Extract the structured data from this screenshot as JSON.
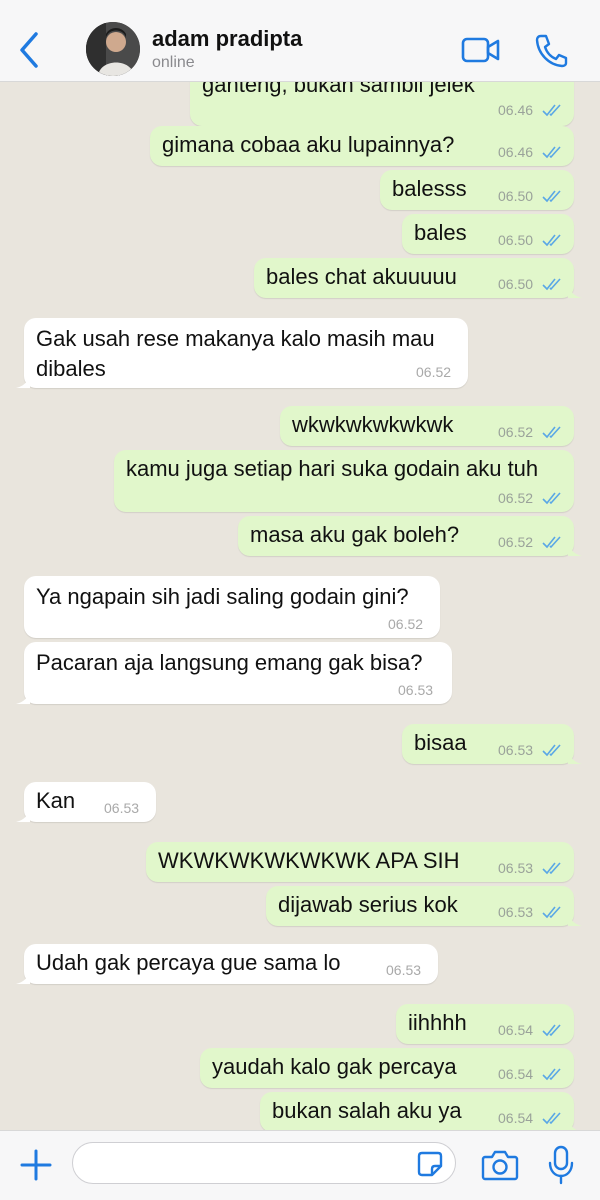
{
  "header": {
    "contact_name": "adam pradipta",
    "status": "online"
  },
  "composer": {
    "placeholder": ""
  },
  "colors": {
    "accent": "#1f7ae0",
    "bubble_out": "#e1f7cb",
    "bubble_in": "#ffffff",
    "chat_bg": "#e9e5dd",
    "read_ticks": "#5aa7e6"
  },
  "messages": [
    {
      "dir": "out",
      "text": "ganteng, bukan sambil jelek",
      "time": "06.46",
      "read": true
    },
    {
      "dir": "out",
      "text": "gimana cobaa aku lupainnya?",
      "time": "06.46",
      "read": true
    },
    {
      "dir": "out",
      "text": "balesss",
      "time": "06.50",
      "read": true
    },
    {
      "dir": "out",
      "text": "bales",
      "time": "06.50",
      "read": true
    },
    {
      "dir": "out",
      "text": "bales chat akuuuuu",
      "time": "06.50",
      "read": true
    },
    {
      "dir": "in",
      "text": "Gak usah rese makanya kalo masih mau\ndibales",
      "time": "06.52"
    },
    {
      "dir": "out",
      "text": "wkwkwkwkwkwk",
      "time": "06.52",
      "read": true
    },
    {
      "dir": "out",
      "text": "kamu juga setiap hari suka godain aku tuh",
      "time": "06.52",
      "read": true
    },
    {
      "dir": "out",
      "text": "masa aku gak boleh?",
      "time": "06.52",
      "read": true
    },
    {
      "dir": "in",
      "text": "Ya ngapain sih jadi saling godain gini?",
      "time": "06.52"
    },
    {
      "dir": "in",
      "text": "Pacaran aja langsung emang gak bisa?",
      "time": "06.53"
    },
    {
      "dir": "out",
      "text": "bisaa",
      "time": "06.53",
      "read": true
    },
    {
      "dir": "in",
      "text": "Kan",
      "time": "06.53"
    },
    {
      "dir": "out",
      "text": "WKWKWKWKWKWK APA SIH",
      "time": "06.53",
      "read": true
    },
    {
      "dir": "out",
      "text": "dijawab serius kok",
      "time": "06.53",
      "read": true
    },
    {
      "dir": "in",
      "text": "Udah gak percaya gue sama lo",
      "time": "06.53"
    },
    {
      "dir": "out",
      "text": "iihhhh",
      "time": "06.54",
      "read": true
    },
    {
      "dir": "out",
      "text": "yaudah kalo gak percaya",
      "time": "06.54",
      "read": true
    },
    {
      "dir": "out",
      "text": "bukan salah aku ya",
      "time": "06.54",
      "read": true
    }
  ]
}
